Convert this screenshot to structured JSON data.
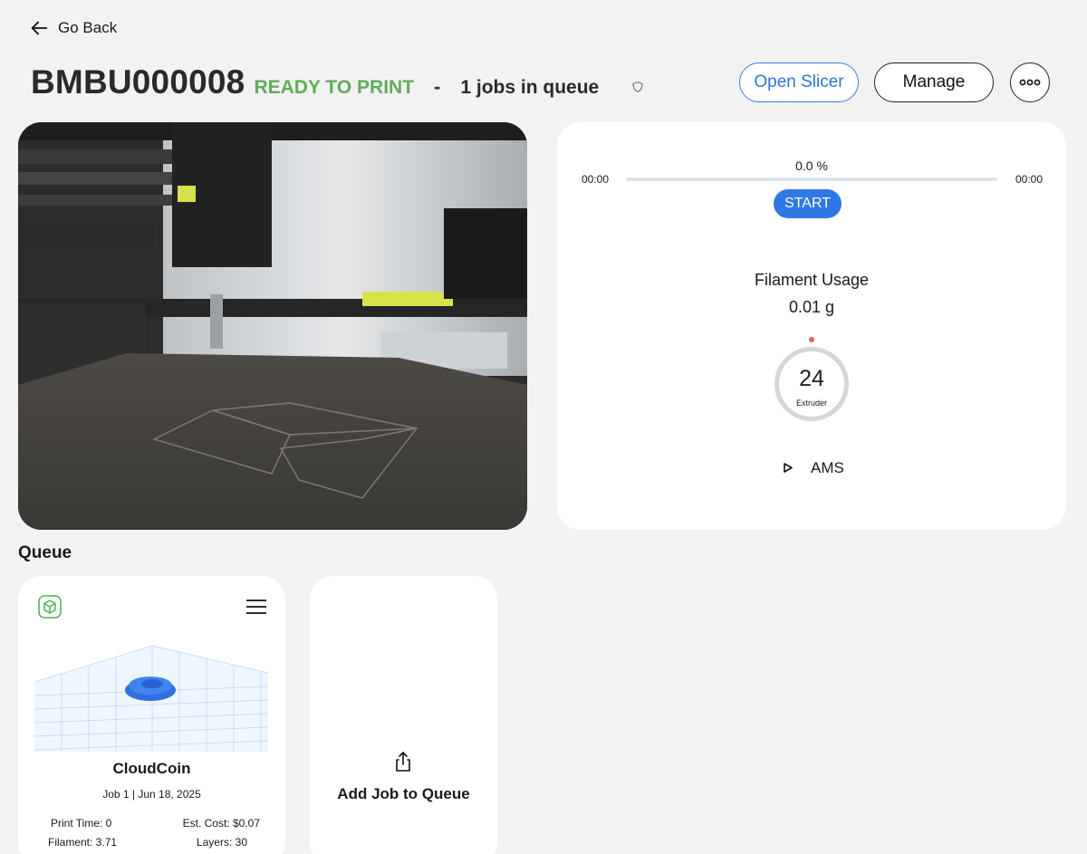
{
  "nav": {
    "back_label": "Go Back"
  },
  "printer": {
    "name": "BMBU000008",
    "status": "READY TO PRINT",
    "separator": "-",
    "queue_count_text": "1 jobs in queue"
  },
  "actions": {
    "open_slicer": "Open Slicer",
    "manage": "Manage",
    "more_icon": "ellipsis-icon"
  },
  "camera": {
    "alt": "printer camera view"
  },
  "print_status": {
    "percent_text": "0.0 %",
    "progress_fraction": 0.0,
    "elapsed": "00:00",
    "remaining": "00:00",
    "start_label": "START",
    "filament_title": "Filament Usage",
    "filament_value": "0.01 g",
    "extruder_temp": "24",
    "extruder_label": "Extruder",
    "ams_label": "AMS"
  },
  "queue": {
    "heading": "Queue",
    "jobs": [
      {
        "name": "CloudCoin",
        "meta": "Job 1 | Jun 18, 2025",
        "print_time": "Print Time: 0",
        "est_cost": "Est. Cost: $0.07",
        "filament": "Filament: 3.71",
        "layers": "Layers: 30"
      }
    ],
    "add_label": "Add Job to Queue"
  },
  "colors": {
    "accent": "#2f77e6",
    "ready": "#5fae57",
    "temp_dot": "#e8643a",
    "background": "#f2f2f2"
  }
}
